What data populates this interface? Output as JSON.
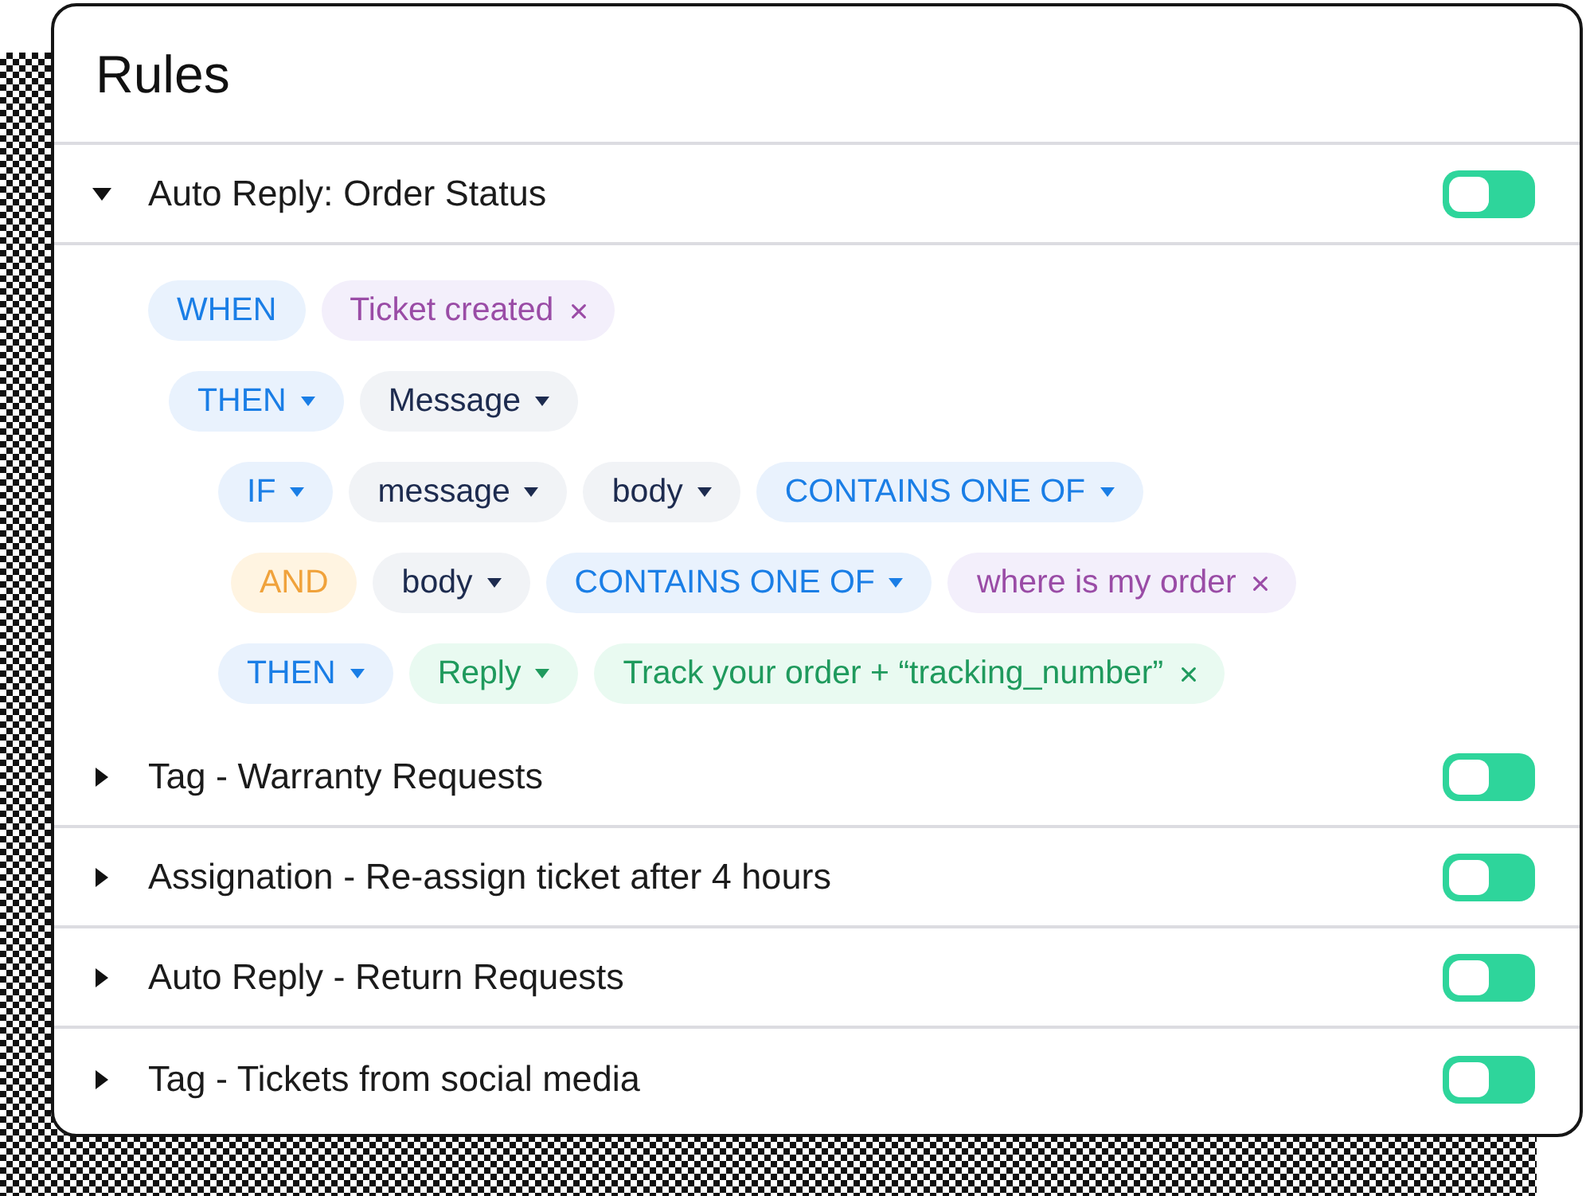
{
  "title": "Rules",
  "rules": [
    {
      "name": "Auto Reply: Order Status",
      "expanded": true,
      "on": false,
      "conditions": [
        {
          "chips": [
            {
              "kind": "keyword",
              "label": "WHEN",
              "dropdown": false,
              "removable": false
            },
            {
              "kind": "condition",
              "label": "Ticket created",
              "dropdown": false,
              "removable": true
            }
          ],
          "children": [
            {
              "chips": [
                {
                  "kind": "keyword",
                  "label": "THEN",
                  "dropdown": true,
                  "removable": false
                },
                {
                  "kind": "field",
                  "label": "Message",
                  "dropdown": true,
                  "removable": false
                }
              ],
              "children": [
                {
                  "chips": [
                    {
                      "kind": "keyword",
                      "label": "IF",
                      "dropdown": true,
                      "removable": false
                    },
                    {
                      "kind": "field",
                      "label": "message",
                      "dropdown": true,
                      "removable": false
                    },
                    {
                      "kind": "field",
                      "label": "body",
                      "dropdown": true,
                      "removable": false
                    },
                    {
                      "kind": "keyword",
                      "label": "CONTAINS ONE OF",
                      "dropdown": true,
                      "removable": false
                    }
                  ],
                  "children": [
                    {
                      "chips": [
                        {
                          "kind": "logic",
                          "label": "AND",
                          "dropdown": false,
                          "removable": false
                        },
                        {
                          "kind": "field",
                          "label": "body",
                          "dropdown": true,
                          "removable": false
                        },
                        {
                          "kind": "keyword",
                          "label": "CONTAINS ONE OF",
                          "dropdown": true,
                          "removable": false
                        },
                        {
                          "kind": "condition",
                          "label": "where is my order",
                          "dropdown": false,
                          "removable": true
                        }
                      ]
                    }
                  ]
                },
                {
                  "chips": [
                    {
                      "kind": "keyword",
                      "label": "THEN",
                      "dropdown": true,
                      "removable": false
                    },
                    {
                      "kind": "action",
                      "label": "Reply",
                      "dropdown": true,
                      "removable": false
                    },
                    {
                      "kind": "action",
                      "label": "Track your order + “tracking_number”",
                      "dropdown": false,
                      "removable": true
                    }
                  ]
                }
              ]
            }
          ]
        }
      ]
    },
    {
      "name": "Tag - Warranty Requests",
      "expanded": false,
      "on": false
    },
    {
      "name": "Assignation - Re-assign ticket after 4 hours",
      "expanded": false,
      "on": false
    },
    {
      "name": "Auto Reply - Return Requests",
      "expanded": false,
      "on": false
    },
    {
      "name": "Tag - Tickets from social media",
      "expanded": false,
      "on": false
    }
  ]
}
